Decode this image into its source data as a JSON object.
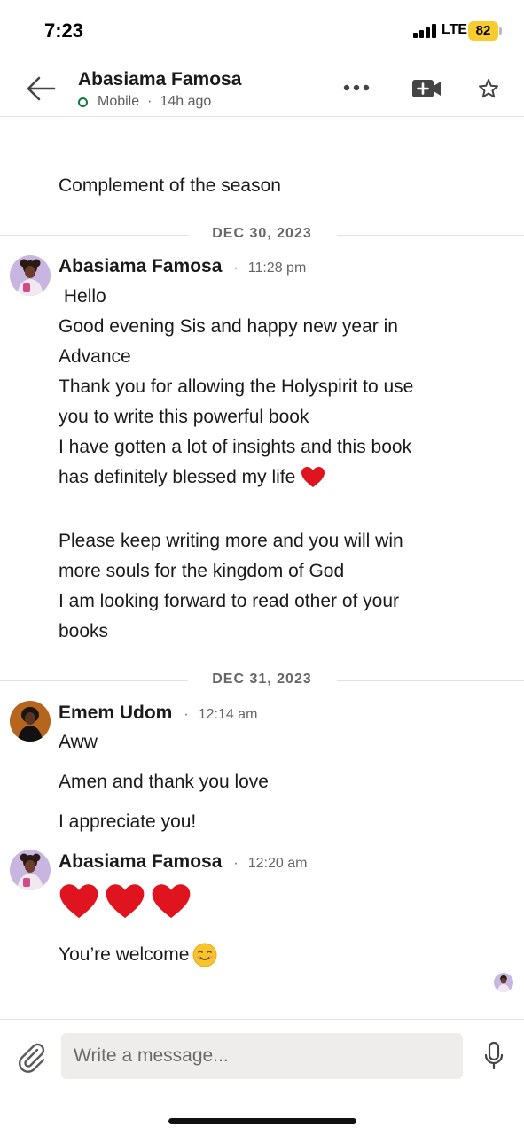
{
  "status_bar": {
    "time": "7:23",
    "network": "LTE",
    "battery": "82"
  },
  "header": {
    "contact_name": "Abasiama Famosa",
    "presence": "Mobile",
    "separator": "·",
    "last_seen": "14h ago"
  },
  "messages": {
    "top_text": "Complement of the season",
    "dividers": [
      "DEC 30, 2023",
      "DEC 31, 2023"
    ],
    "groups": [
      {
        "sender": "Abasiama Famosa",
        "time": "11:28 pm",
        "text": " Hello\nGood evening Sis and happy new year in\nAdvance\nThank you for allowing the Holyspirit to use\nyou to write this powerful book\nI have gotten a lot of insights and this book\nhas definitely blessed my life",
        "text2": "Please keep writing more and you will win\nmore souls for the kingdom of God\nI am looking forward to read other of your\nbooks"
      },
      {
        "sender": "Emem Udom",
        "time": "12:14 am",
        "lines": [
          "Aww",
          "Amen and thank you love",
          "I appreciate you!"
        ]
      },
      {
        "sender": "Abasiama Famosa",
        "time": "12:20 am",
        "text": "You’re welcome"
      }
    ]
  },
  "composer": {
    "placeholder": "Write a message..."
  },
  "colors": {
    "online": "#0f7b3a",
    "battery": "#f7cc2f",
    "heart": "#e0141e"
  },
  "icons": [
    "back-arrow-icon",
    "more-icon",
    "video-call-icon",
    "star-icon",
    "paperclip-icon",
    "microphone-icon",
    "heart-icon",
    "smiling-face-icon"
  ]
}
